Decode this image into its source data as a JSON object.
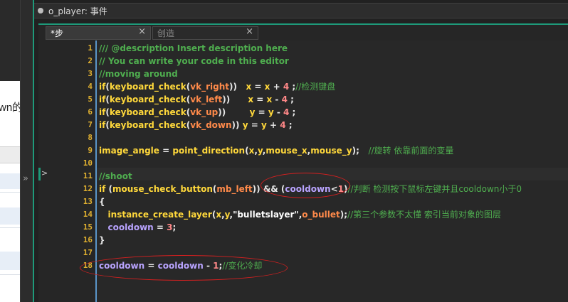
{
  "background_page": {
    "partial_text": "wn的"
  },
  "strip": {
    "arrow": "»"
  },
  "window": {
    "title": "o_player: 事件"
  },
  "tabs": [
    {
      "label": "*步",
      "close": "×",
      "active": true
    },
    {
      "label": "创造",
      "close": "×",
      "active": false
    }
  ],
  "gutter": {
    "marker": ">"
  },
  "colors": {
    "accent": "#1e9a7a",
    "line_number": "#e0b030",
    "comment": "#4fae4f",
    "function": "#ffd83b",
    "variable": "#b9a4ff",
    "number": "#ff8888",
    "annotation": "#d42020"
  },
  "code_lines": [
    {
      "n": "1",
      "tokens": [
        {
          "t": "/// @description Insert description here",
          "c": "cm"
        }
      ]
    },
    {
      "n": "2",
      "tokens": [
        {
          "t": "// You can write your code in this editor",
          "c": "cm"
        }
      ]
    },
    {
      "n": "3",
      "tokens": [
        {
          "t": "//moving around",
          "c": "cm"
        }
      ]
    },
    {
      "n": "4",
      "tokens": [
        {
          "t": "if",
          "c": "kw"
        },
        {
          "t": "(",
          "c": "pn"
        },
        {
          "t": "keyboard_check",
          "c": "fn"
        },
        {
          "t": "(",
          "c": "pn"
        },
        {
          "t": "vk_right",
          "c": "res"
        },
        {
          "t": "))   ",
          "c": "pn"
        },
        {
          "t": "x",
          "c": "fn"
        },
        {
          "t": " = ",
          "c": "op"
        },
        {
          "t": "x",
          "c": "fn"
        },
        {
          "t": " + ",
          "c": "op"
        },
        {
          "t": "4",
          "c": "nm"
        },
        {
          "t": " ;",
          "c": "pn"
        },
        {
          "t": "//检测键盘",
          "c": "cm2"
        }
      ]
    },
    {
      "n": "5",
      "tokens": [
        {
          "t": "if",
          "c": "kw"
        },
        {
          "t": "(",
          "c": "pn"
        },
        {
          "t": "keyboard_check",
          "c": "fn"
        },
        {
          "t": "(",
          "c": "pn"
        },
        {
          "t": "vk_left",
          "c": "res"
        },
        {
          "t": "))      ",
          "c": "pn"
        },
        {
          "t": "x",
          "c": "fn"
        },
        {
          "t": " = ",
          "c": "op"
        },
        {
          "t": "x",
          "c": "fn"
        },
        {
          "t": " - ",
          "c": "op"
        },
        {
          "t": "4",
          "c": "nm"
        },
        {
          "t": " ;",
          "c": "pn"
        }
      ]
    },
    {
      "n": "6",
      "tokens": [
        {
          "t": "if",
          "c": "kw"
        },
        {
          "t": "(",
          "c": "pn"
        },
        {
          "t": "keyboard_check",
          "c": "fn"
        },
        {
          "t": "(",
          "c": "pn"
        },
        {
          "t": "vk_up",
          "c": "res"
        },
        {
          "t": "))        ",
          "c": "pn"
        },
        {
          "t": "y",
          "c": "fn"
        },
        {
          "t": " = ",
          "c": "op"
        },
        {
          "t": "y",
          "c": "fn"
        },
        {
          "t": " - ",
          "c": "op"
        },
        {
          "t": "4",
          "c": "nm"
        },
        {
          "t": " ;",
          "c": "pn"
        }
      ]
    },
    {
      "n": "7",
      "tokens": [
        {
          "t": "if",
          "c": "kw"
        },
        {
          "t": "(",
          "c": "pn"
        },
        {
          "t": "keyboard_check",
          "c": "fn"
        },
        {
          "t": "(",
          "c": "pn"
        },
        {
          "t": "vk_down",
          "c": "res"
        },
        {
          "t": ")) ",
          "c": "pn"
        },
        {
          "t": "y",
          "c": "fn"
        },
        {
          "t": " = ",
          "c": "op"
        },
        {
          "t": "y",
          "c": "fn"
        },
        {
          "t": " + ",
          "c": "op"
        },
        {
          "t": "4",
          "c": "nm"
        },
        {
          "t": " ;",
          "c": "pn"
        }
      ]
    },
    {
      "n": "8",
      "tokens": []
    },
    {
      "n": "9",
      "tokens": [
        {
          "t": "image_angle",
          "c": "fn"
        },
        {
          "t": " = ",
          "c": "op"
        },
        {
          "t": "point_direction",
          "c": "fn"
        },
        {
          "t": "(",
          "c": "pn"
        },
        {
          "t": "x",
          "c": "fn"
        },
        {
          "t": ",",
          "c": "pn"
        },
        {
          "t": "y",
          "c": "fn"
        },
        {
          "t": ",",
          "c": "pn"
        },
        {
          "t": "mouse_x",
          "c": "fn"
        },
        {
          "t": ",",
          "c": "pn"
        },
        {
          "t": "mouse_y",
          "c": "fn"
        },
        {
          "t": ");   ",
          "c": "pn"
        },
        {
          "t": "//旋转 依靠前面的变量",
          "c": "cm2"
        }
      ]
    },
    {
      "n": "10",
      "tokens": []
    },
    {
      "n": "11",
      "tokens": [
        {
          "t": "//shoot",
          "c": "cm"
        }
      ]
    },
    {
      "n": "12",
      "tokens": [
        {
          "t": "if",
          "c": "kw"
        },
        {
          "t": " (",
          "c": "pn"
        },
        {
          "t": "mouse_check_button",
          "c": "fn"
        },
        {
          "t": "(",
          "c": "pn"
        },
        {
          "t": "mb_left",
          "c": "res"
        },
        {
          "t": ")) && (",
          "c": "pn"
        },
        {
          "t": "cooldown",
          "c": "vr"
        },
        {
          "t": "<",
          "c": "op"
        },
        {
          "t": "1",
          "c": "nm"
        },
        {
          "t": ")",
          "c": "pn"
        },
        {
          "t": "//判断 检测按下鼠标左键并且cooldown小于0",
          "c": "cm2"
        }
      ]
    },
    {
      "n": "13",
      "tokens": [
        {
          "t": "{",
          "c": "pn"
        }
      ]
    },
    {
      "n": "14",
      "tokens": [
        {
          "t": "   instance_create_layer",
          "c": "fn"
        },
        {
          "t": "(",
          "c": "pn"
        },
        {
          "t": "x",
          "c": "fn"
        },
        {
          "t": ",",
          "c": "pn"
        },
        {
          "t": "y",
          "c": "fn"
        },
        {
          "t": ",",
          "c": "pn"
        },
        {
          "t": "\"bulletslayer\"",
          "c": "st"
        },
        {
          "t": ",",
          "c": "pn"
        },
        {
          "t": "o_bullet",
          "c": "res"
        },
        {
          "t": ");",
          "c": "pn"
        },
        {
          "t": "//第三个参数不太懂 索引当前对象的图层",
          "c": "cm2"
        }
      ]
    },
    {
      "n": "15",
      "tokens": [
        {
          "t": "   cooldown",
          "c": "vr"
        },
        {
          "t": " = ",
          "c": "op"
        },
        {
          "t": "3",
          "c": "nm"
        },
        {
          "t": ";",
          "c": "pn"
        }
      ]
    },
    {
      "n": "16",
      "tokens": [
        {
          "t": "}",
          "c": "pn"
        }
      ]
    },
    {
      "n": "17",
      "tokens": []
    },
    {
      "n": "18",
      "tokens": [
        {
          "t": "cooldown",
          "c": "vr"
        },
        {
          "t": " = ",
          "c": "op"
        },
        {
          "t": "cooldown",
          "c": "vr"
        },
        {
          "t": " - ",
          "c": "op"
        },
        {
          "t": "1",
          "c": "nm"
        },
        {
          "t": ";",
          "c": "pn"
        },
        {
          "t": "//变化冷却",
          "c": "cm2"
        }
      ]
    }
  ]
}
